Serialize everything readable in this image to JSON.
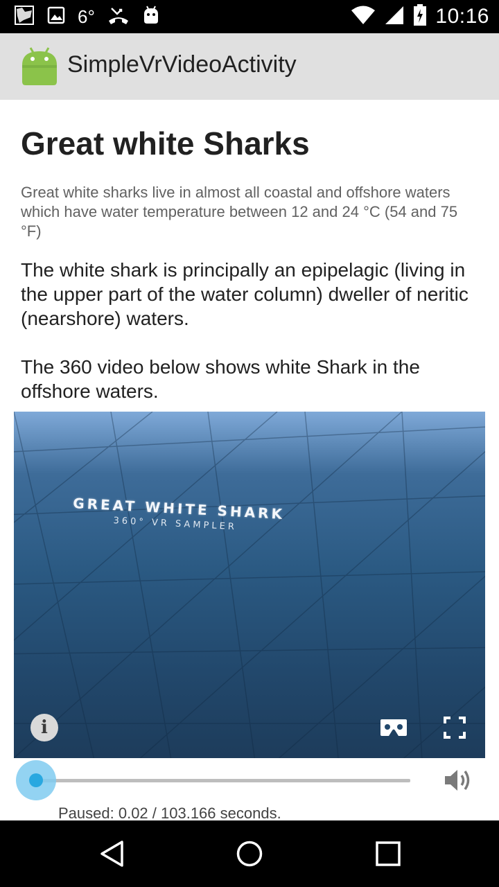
{
  "status_bar": {
    "temperature": "6°",
    "time": "10:16",
    "icons": [
      "screenshot-icon",
      "image-icon",
      "temperature",
      "missed-call-icon",
      "android-debug-icon",
      "wifi-icon",
      "signal-icon",
      "battery-icon"
    ]
  },
  "app_bar": {
    "title": "SimpleVrVideoActivity",
    "logo": "android-logo"
  },
  "article": {
    "title": "Great white Sharks",
    "subtitle": "Great white sharks live in almost all coastal and offshore waters which have water temperature between 12 and 24 °C (54 and 75 °F)",
    "paragraphs": [
      "The white shark is principally an epipelagic (living in the upper part of the water column) dweller of neritic (nearshore) waters.",
      "The 360 video below shows white Shark in the offshore waters."
    ]
  },
  "video": {
    "overlay_title": "GREAT WHITE SHARK",
    "overlay_subtitle": "360° VR SAMPLER",
    "info_label": "i",
    "controls": [
      "info-icon",
      "cardboard-icon",
      "fullscreen-icon"
    ]
  },
  "player": {
    "progress_fraction": 0.0002,
    "status": "Paused: 0.02 / 103.166 seconds.",
    "volume_icon": "volume-icon"
  },
  "nav_bar": {
    "buttons": [
      "back-icon",
      "home-icon",
      "recents-icon"
    ]
  }
}
